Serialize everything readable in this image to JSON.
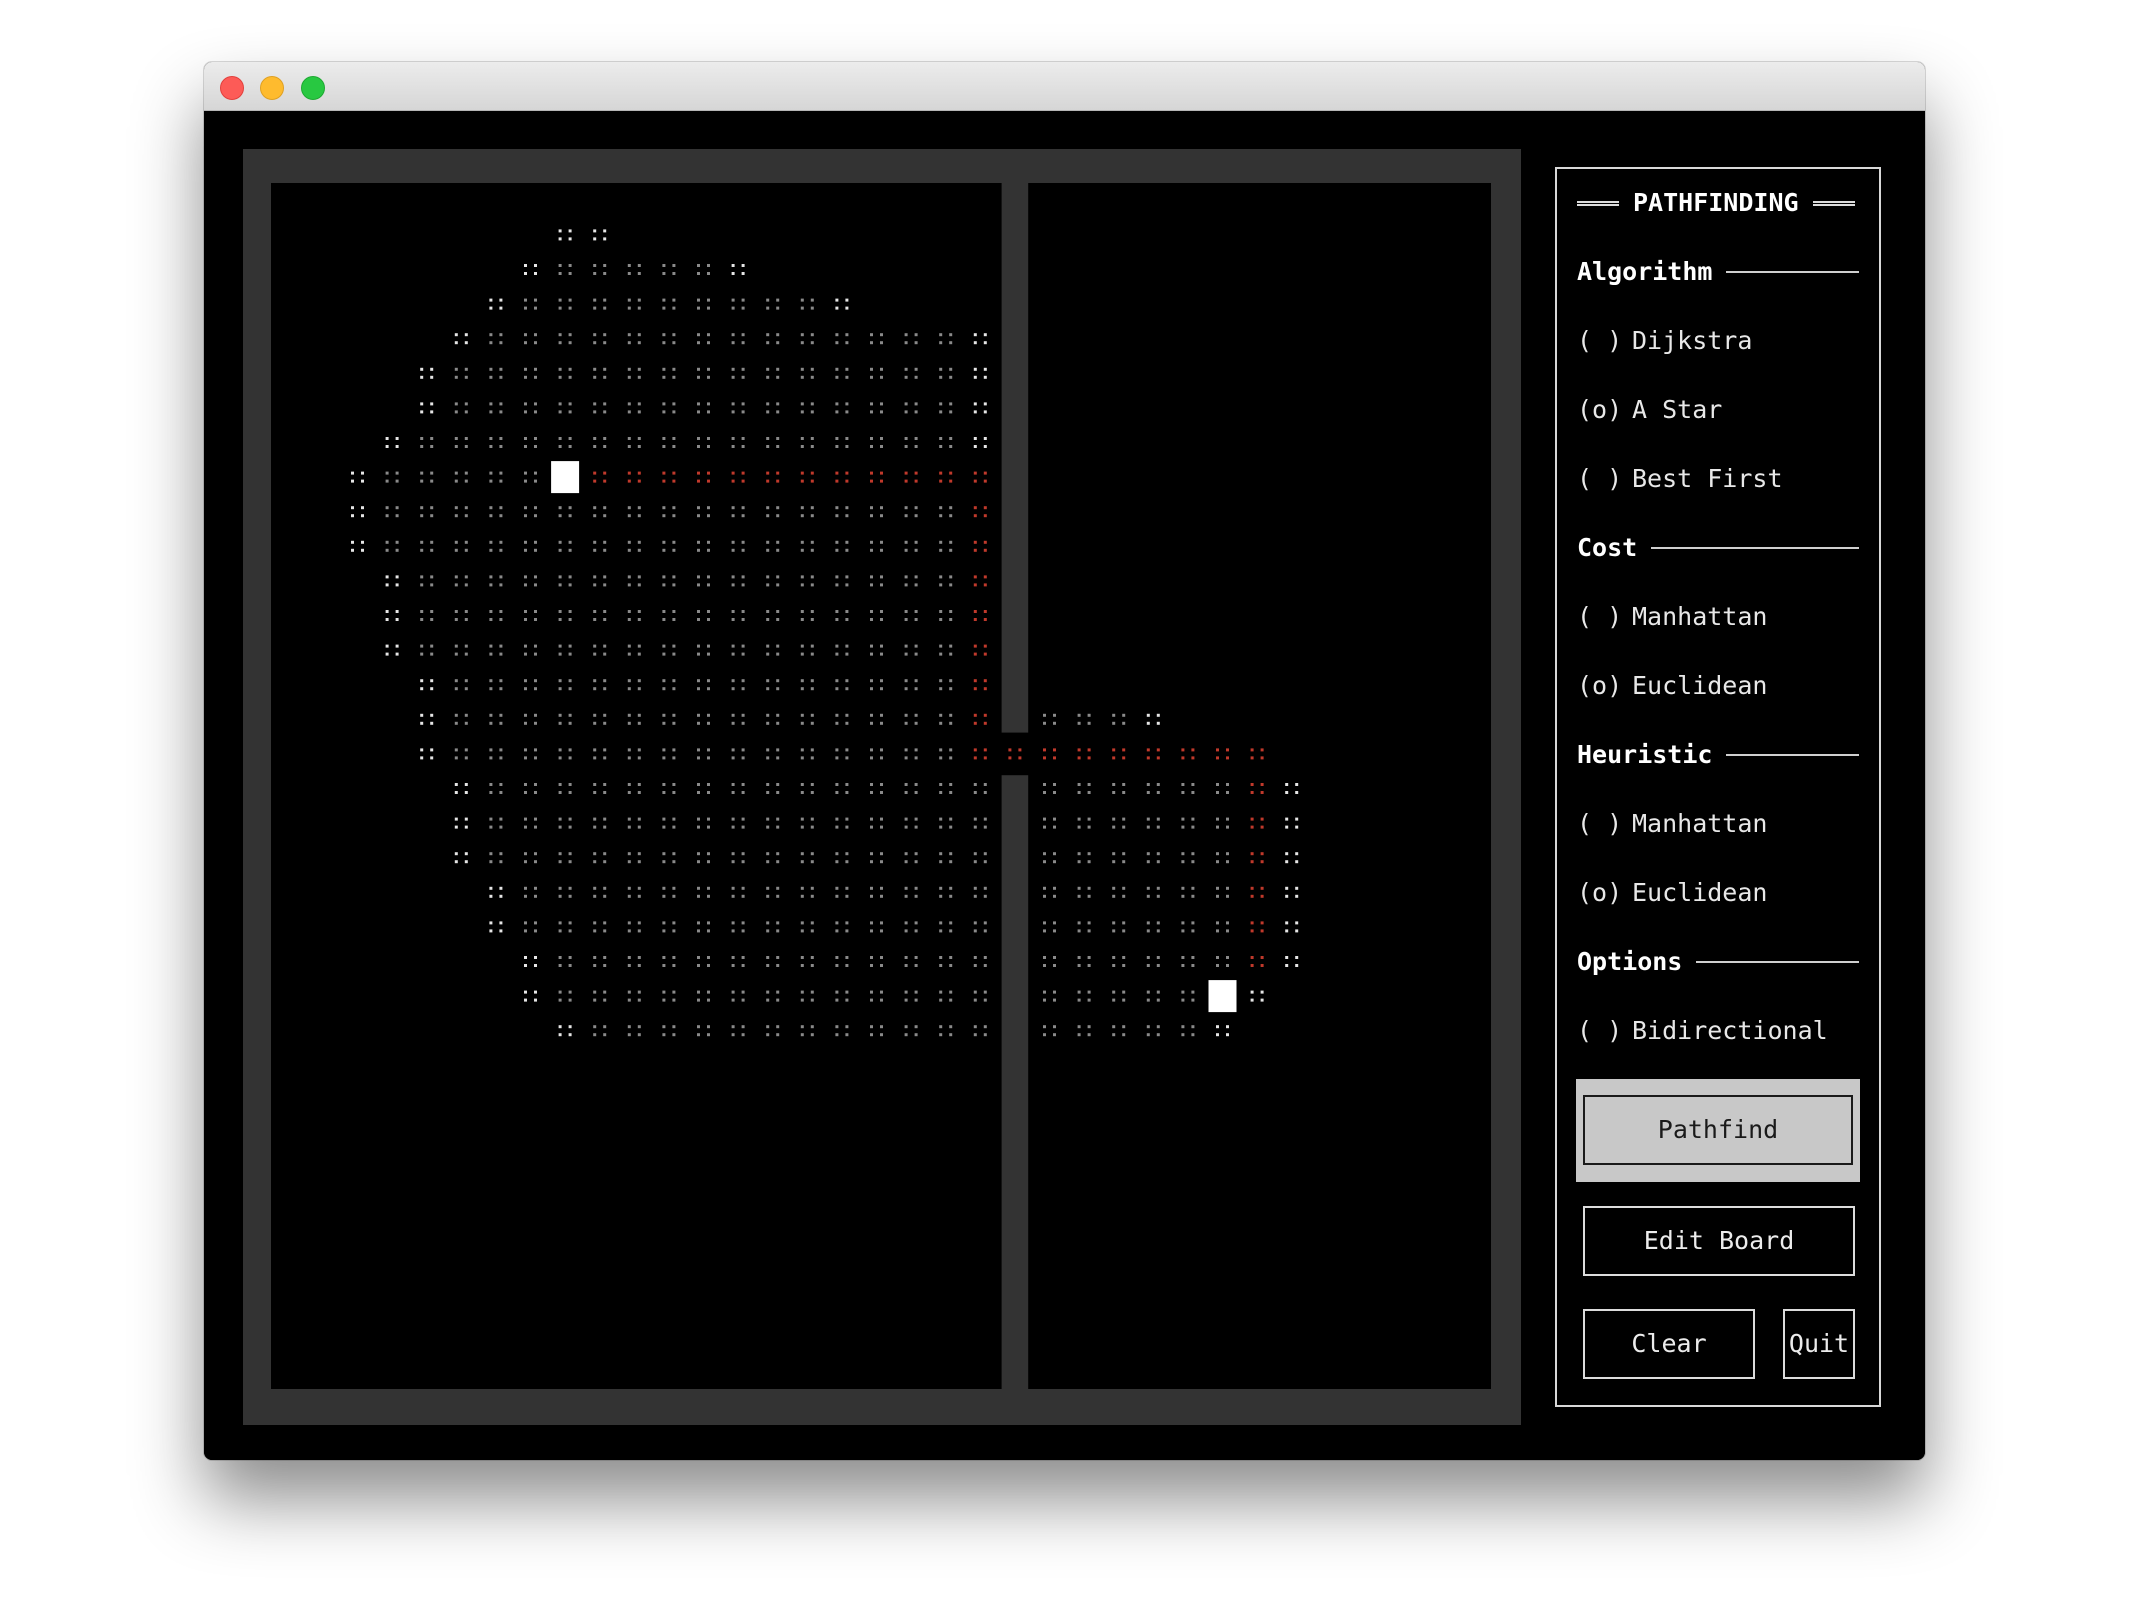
{
  "panel": {
    "title": "PATHFINDING",
    "sections": {
      "algorithm": {
        "label": "Algorithm",
        "options": [
          {
            "mark": "( )",
            "label": "Dijkstra"
          },
          {
            "mark": "(o)",
            "label": "A Star"
          },
          {
            "mark": "( )",
            "label": "Best First"
          }
        ]
      },
      "cost": {
        "label": "Cost",
        "options": [
          {
            "mark": "( )",
            "label": "Manhattan"
          },
          {
            "mark": "(o)",
            "label": "Euclidean"
          }
        ]
      },
      "heuristic": {
        "label": "Heuristic",
        "options": [
          {
            "mark": "( )",
            "label": "Manhattan"
          },
          {
            "mark": "(o)",
            "label": "Euclidean"
          }
        ]
      },
      "options": {
        "label": "Options",
        "options": [
          {
            "mark": "( )",
            "label": "Bidirectional"
          }
        ]
      }
    },
    "buttons": {
      "pathfind": "Pathfind",
      "edit_board": "Edit Board",
      "clear": "Clear",
      "quit": "Quit"
    }
  },
  "colors": {
    "board_frame": "#333333",
    "board_bg": "#000000",
    "explored": "#8a8a8a",
    "frontier": "#e6e6e6",
    "path": "#c0392b",
    "start_goal": "#ffffff"
  },
  "board": {
    "explored_rows": [
      {
        "row": 1,
        "from": 8,
        "to": 9
      },
      {
        "row": 2,
        "from": 7,
        "to": 13
      },
      {
        "row": 3,
        "from": 6,
        "to": 16
      },
      {
        "row": 4,
        "from": 5,
        "to": 20
      },
      {
        "row": 5,
        "from": 4,
        "to": 20
      },
      {
        "row": 6,
        "from": 4,
        "to": 20
      },
      {
        "row": 7,
        "from": 3,
        "to": 20
      },
      {
        "row": 8,
        "from": 2,
        "to": 20
      },
      {
        "row": 9,
        "from": 2,
        "to": 20
      },
      {
        "row": 10,
        "from": 2,
        "to": 20
      },
      {
        "row": 11,
        "from": 3,
        "to": 20
      },
      {
        "row": 12,
        "from": 3,
        "to": 20
      },
      {
        "row": 13,
        "from": 3,
        "to": 20
      },
      {
        "row": 14,
        "from": 4,
        "to": 20
      },
      {
        "row": 15,
        "from": 4,
        "to": 25
      },
      {
        "row": 16,
        "from": 4,
        "to": 28
      },
      {
        "row": 17,
        "from": 5,
        "to": 29
      },
      {
        "row": 18,
        "from": 5,
        "to": 29
      },
      {
        "row": 19,
        "from": 5,
        "to": 29
      },
      {
        "row": 20,
        "from": 6,
        "to": 29
      },
      {
        "row": 21,
        "from": 6,
        "to": 29
      },
      {
        "row": 22,
        "from": 7,
        "to": 29
      },
      {
        "row": 23,
        "from": 7,
        "to": 28
      },
      {
        "row": 24,
        "from": 8,
        "to": 27
      }
    ],
    "path_cells": [
      {
        "row": 8,
        "from": 9,
        "to": 20
      },
      {
        "row": 9,
        "from": 20,
        "to": 20
      },
      {
        "row": 10,
        "from": 20,
        "to": 20
      },
      {
        "row": 11,
        "from": 20,
        "to": 20
      },
      {
        "row": 12,
        "from": 20,
        "to": 20
      },
      {
        "row": 13,
        "from": 20,
        "to": 20
      },
      {
        "row": 14,
        "from": 20,
        "to": 20
      },
      {
        "row": 15,
        "from": 20,
        "to": 20
      },
      {
        "row": 16,
        "from": 20,
        "to": 28
      },
      {
        "row": 17,
        "from": 28,
        "to": 28
      },
      {
        "row": 18,
        "from": 28,
        "to": 28
      },
      {
        "row": 19,
        "from": 28,
        "to": 28
      },
      {
        "row": 20,
        "from": 28,
        "to": 28
      },
      {
        "row": 21,
        "from": 28,
        "to": 28
      },
      {
        "row": 22,
        "from": 28,
        "to": 28
      }
    ],
    "start": {
      "row": 8,
      "col": 8
    },
    "goal": {
      "row": 23,
      "col": 27
    },
    "wall_col": 21,
    "wall_gap_row": 16
  }
}
